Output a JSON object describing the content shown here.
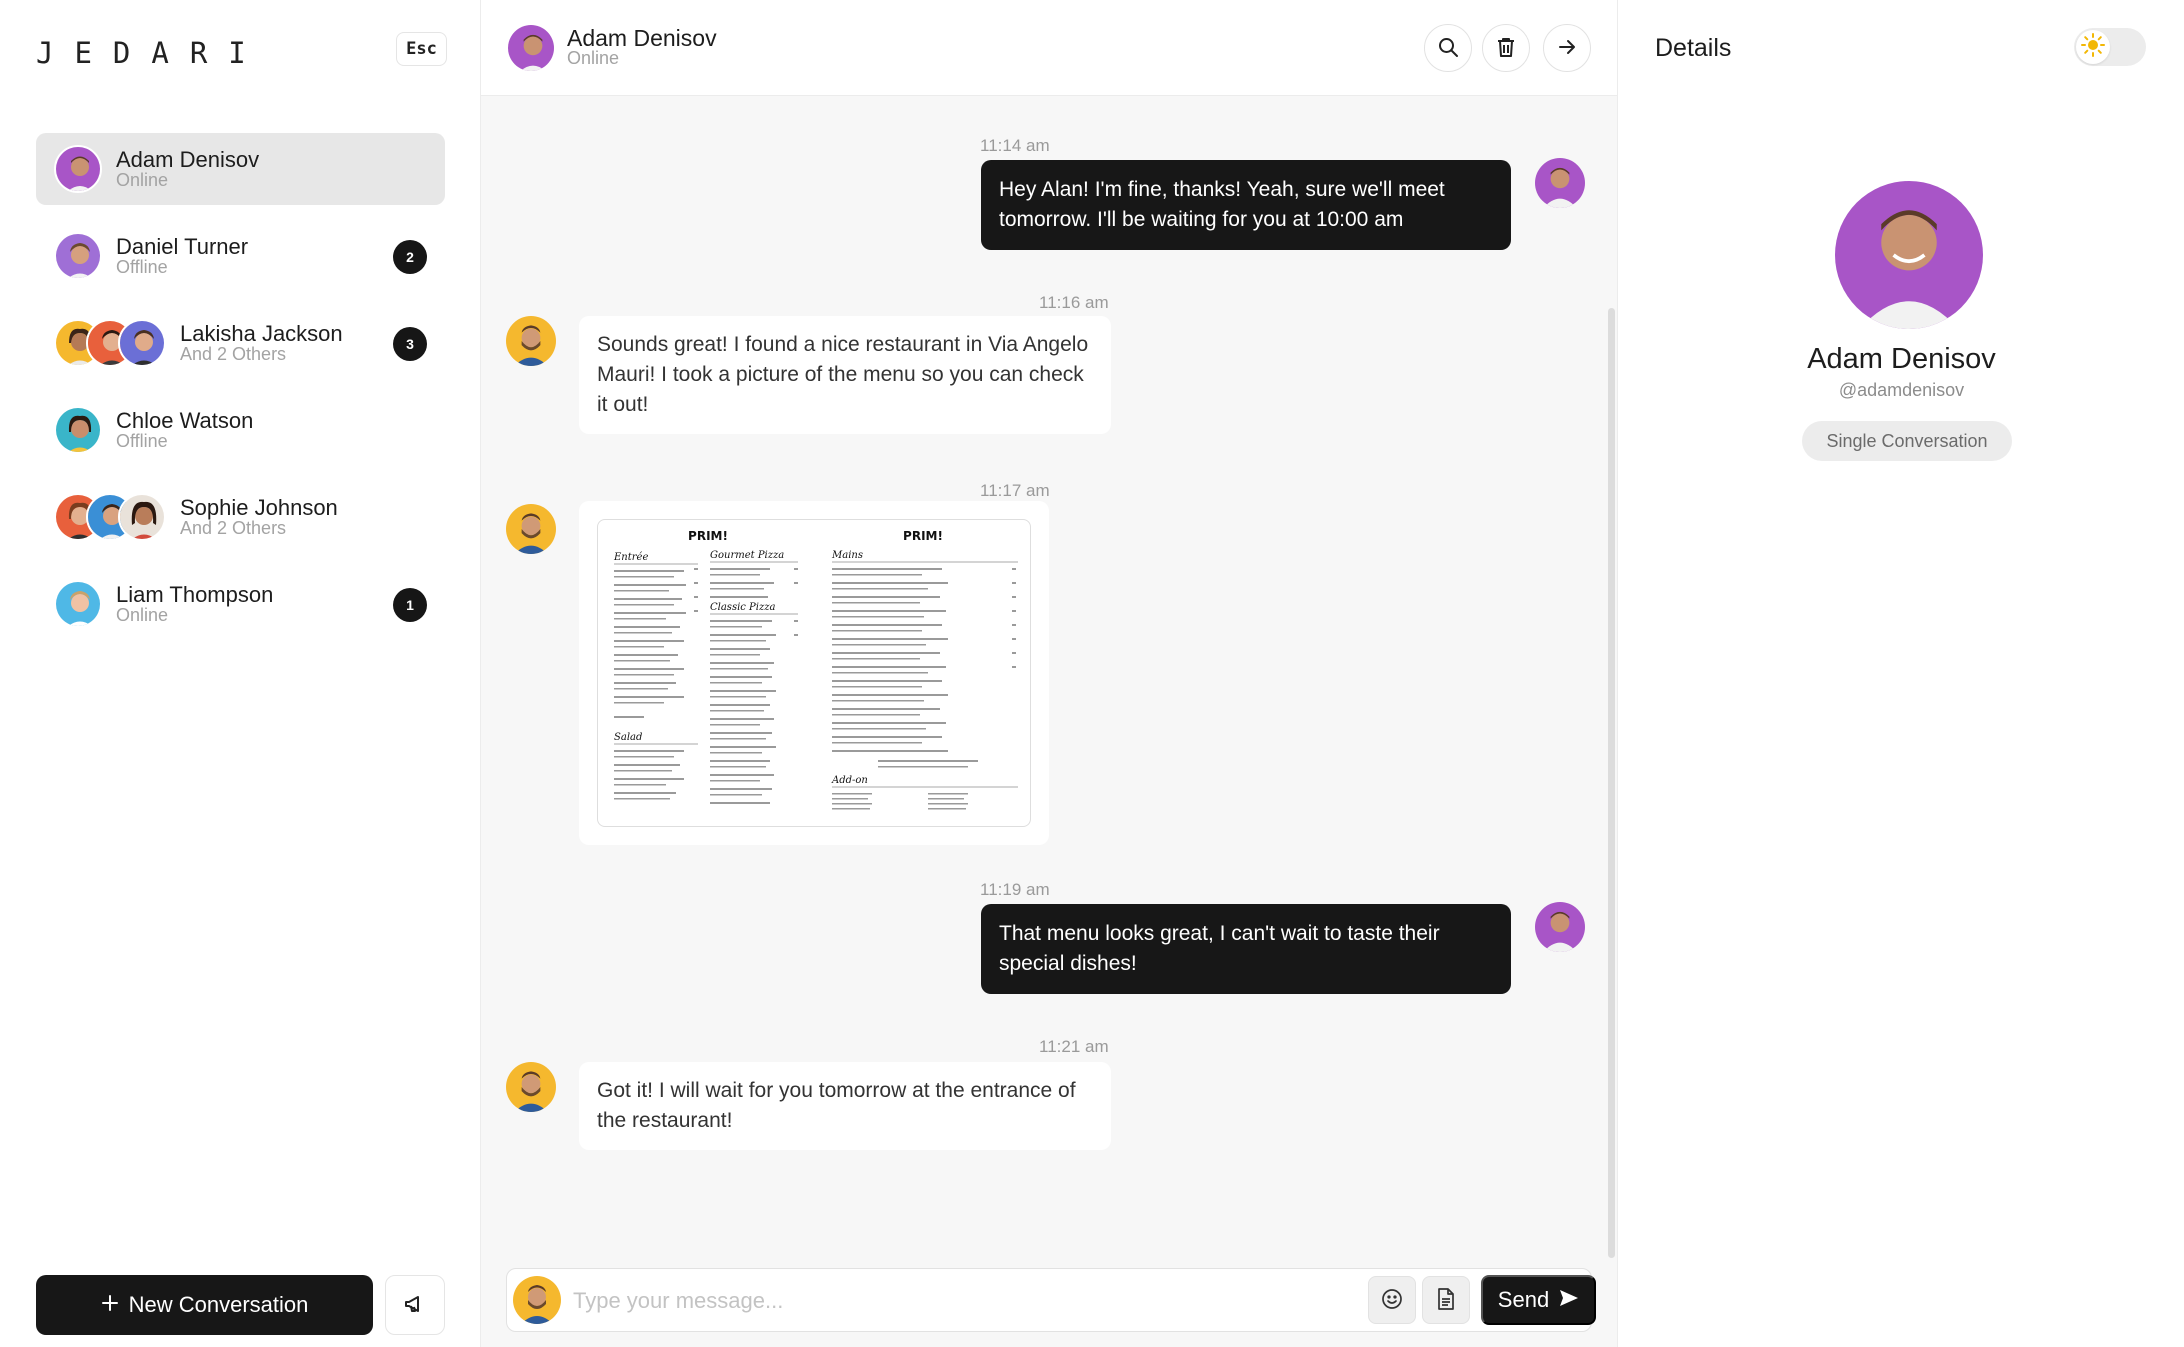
{
  "brand": {
    "logo_text": "JEDARI"
  },
  "sidebar": {
    "esc_label": "Esc",
    "conversations": [
      {
        "name": "Adam Denisov",
        "status": "Online",
        "badge": "",
        "active": true
      },
      {
        "name": "Daniel Turner",
        "status": "Offline",
        "badge": "2"
      },
      {
        "name": "Lakisha Jackson",
        "status": "And 2 Others",
        "badge": "3"
      },
      {
        "name": "Chloe Watson",
        "status": "Offline",
        "badge": ""
      },
      {
        "name": "Sophie Johnson",
        "status": "And 2 Others",
        "badge": ""
      },
      {
        "name": "Liam Thompson",
        "status": "Online",
        "badge": "1"
      }
    ],
    "new_conversation_label": "New Conversation"
  },
  "chat": {
    "header": {
      "name": "Adam Denisov",
      "status": "Online"
    },
    "messages": [
      {
        "time": "11:14 am",
        "direction": "out",
        "text": "Hey Alan! I'm fine, thanks! Yeah, sure we'll meet tomorrow. I'll be waiting for you at 10:00 am"
      },
      {
        "time": "11:16 am",
        "direction": "in",
        "text": "Sounds great! I found a nice restaurant in Via Angelo Mauri! I took a picture of the menu so you can check it out!"
      },
      {
        "time": "11:17 am",
        "direction": "in",
        "attachment": "menu-image",
        "menu": {
          "brand": "PRIM!",
          "sections_left": [
            "Entrée",
            "Gourmet Pizza",
            "Classic Pizza",
            "Salad"
          ],
          "sections_right": [
            "Mains",
            "Add-on"
          ]
        }
      },
      {
        "time": "11:19 am",
        "direction": "out",
        "text": "That menu looks great, I can't wait to taste their special dishes!"
      },
      {
        "time": "11:21 am",
        "direction": "in",
        "text": "Got it! I will wait for you tomorrow at the entrance of the restaurant!"
      }
    ],
    "composer": {
      "placeholder": "Type your message...",
      "send_label": "Send"
    }
  },
  "details": {
    "title": "Details",
    "name": "Adam Denisov",
    "handle": "@adamdenisov",
    "chip": "Single Conversation"
  },
  "colors": {
    "dark": "#171717",
    "chat_bg": "#f7f7f7",
    "muted_text": "#a3a3a3",
    "avatar_purple": "#a855c7",
    "avatar_yellow": "#f5b82e",
    "sun_yellow": "#f2b705"
  },
  "icons": [
    "search-icon",
    "trash-icon",
    "arrow-right-icon",
    "plus-icon",
    "megaphone-icon",
    "emoji-icon",
    "document-icon",
    "send-icon",
    "sun-icon"
  ]
}
